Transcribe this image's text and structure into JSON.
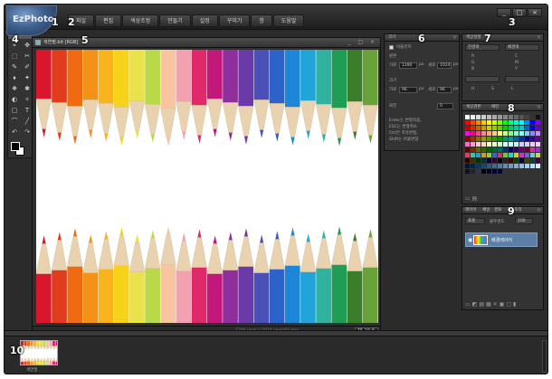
{
  "app": {
    "logo_text": "EzPhoto"
  },
  "menu": [
    "파일",
    "편집",
    "색상조정",
    "만들기",
    "설정",
    "꾸미기",
    "창",
    "도움말"
  ],
  "window_controls": [
    "_",
    "□",
    "×"
  ],
  "callouts": [
    "1",
    "2",
    "3",
    "4",
    "5",
    "6",
    "7",
    "8",
    "9",
    "10"
  ],
  "tools": [
    "⌖",
    "✥",
    "⬚",
    "✂",
    "✎",
    "✐",
    "⬧",
    "✦",
    "❖",
    "✱",
    "◐",
    "✧",
    "▢",
    "T",
    "⌒",
    "╱",
    "↶",
    "↷"
  ],
  "document": {
    "title": "색연필.bit [RGB]",
    "controls": "_ □ ×",
    "status_info": "1280 pixel x 1024 pixel(60 dpi)",
    "zoom": "75.19 %"
  },
  "panel_size": {
    "tab": "크기",
    "keep_ratio_label": "비율유지",
    "section1": "원본",
    "width_label": "가로",
    "width_value": "1280",
    "height_label": "세로",
    "height_value": "1024",
    "unit": "px",
    "section2": "크기",
    "new_width_value": "96",
    "new_height_value": "96",
    "rotate_label": "회전",
    "rotate_value": "0",
    "hints": [
      "Enter는 변형적용,",
      "ESC는 변형취소",
      "Ctrl은 자유변형,",
      "Shift는 비율변형"
    ]
  },
  "panel_color": {
    "tab": "색상설정",
    "dropdown_left": "전경색",
    "dropdown_right": "배경색",
    "labels": [
      "R",
      "G",
      "B",
      "C",
      "M",
      "Y"
    ],
    "rows": [
      "H",
      "S",
      "L"
    ]
  },
  "panel_swatches": {
    "tab": "색상견본",
    "tab2": "패턴"
  },
  "panel_layers": {
    "tabs": [
      "레이어",
      "채널",
      "경로",
      "히스토리"
    ],
    "mode": "표준",
    "opacity_label": "불투명도",
    "opacity_value": "100",
    "layer_name": "배경레이어"
  },
  "filmstrip": {
    "thumb_label": "색연필"
  },
  "colors": {
    "accent": "#5c7fa8",
    "background": "#2b2b2b"
  }
}
